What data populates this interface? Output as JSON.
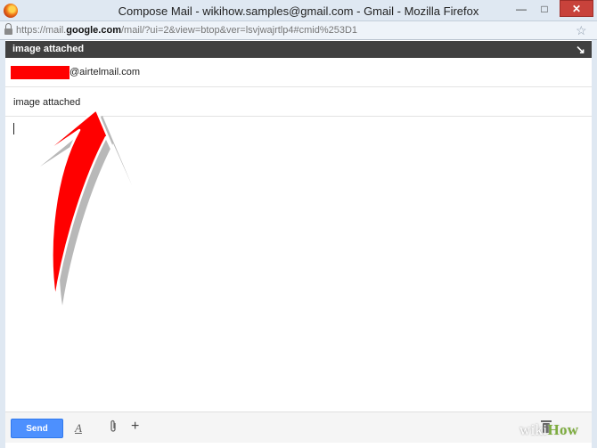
{
  "window": {
    "title": "Compose Mail - wikihow.samples@gmail.com - Gmail - Mozilla Firefox",
    "min_glyph": "—",
    "max_glyph": "□",
    "close_glyph": "✕"
  },
  "address_bar": {
    "url_prefix": "https://mail.",
    "url_domain": "google.com",
    "url_rest": "/mail/?ui=2&view=btop&ver=lsvjwajrtlp4#cmid%253D1"
  },
  "compose": {
    "header_title": "image attached",
    "to_value": "@airtelmail.com",
    "subject_value": "image attached"
  },
  "toolbar": {
    "send_label": "Send",
    "format_glyph": "A",
    "add_glyph": "+"
  },
  "watermark": {
    "wiki": "wiki",
    "how": "How"
  },
  "colors": {
    "send_button": "#4d90fe",
    "header_bar": "#404040",
    "annotation_arrow": "#ff0000",
    "redaction": "#ff0000"
  },
  "icons": [
    "firefox-icon",
    "lock-icon",
    "bookmark-star-icon",
    "popout-icon",
    "format-text-icon",
    "paperclip-icon",
    "plus-icon",
    "trash-icon"
  ]
}
